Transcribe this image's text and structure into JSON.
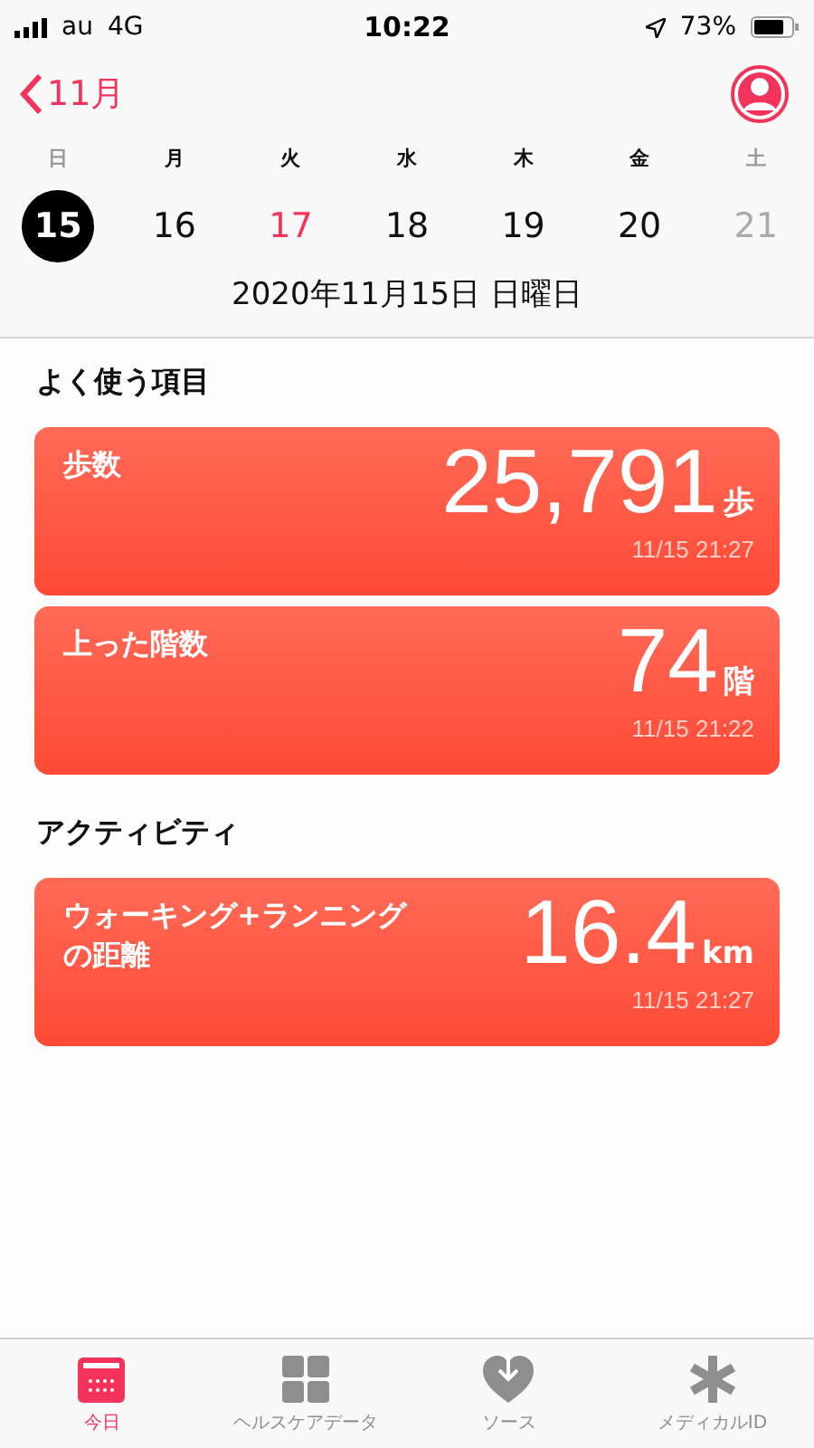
{
  "status_bar": {
    "carrier": "au",
    "network": "4G",
    "time": "10:22",
    "battery": "73%"
  },
  "nav": {
    "back": "11月"
  },
  "week": [
    {
      "weekday": "日",
      "day": "15",
      "weekend": true,
      "selected": true,
      "kind": "past"
    },
    {
      "weekday": "月",
      "day": "16",
      "weekend": false,
      "selected": false,
      "kind": "past"
    },
    {
      "weekday": "火",
      "day": "17",
      "weekend": false,
      "selected": false,
      "kind": "today"
    },
    {
      "weekday": "水",
      "day": "18",
      "weekend": false,
      "selected": false,
      "kind": "past"
    },
    {
      "weekday": "木",
      "day": "19",
      "weekend": false,
      "selected": false,
      "kind": "past"
    },
    {
      "weekday": "金",
      "day": "20",
      "weekend": false,
      "selected": false,
      "kind": "past"
    },
    {
      "weekday": "土",
      "day": "21",
      "weekend": true,
      "selected": false,
      "kind": "future"
    }
  ],
  "date_heading": "2020年11月15日 日曜日",
  "sections": [
    {
      "title": "よく使う項目",
      "cards": [
        {
          "label": "歩数",
          "value": "25,791",
          "unit": "歩",
          "time": "11/15 21:27"
        },
        {
          "label": "上った階数",
          "value": "74",
          "unit": "階",
          "time": "11/15 21:22"
        }
      ]
    },
    {
      "title": "アクティビティ",
      "cards": [
        {
          "label": "ウォーキング+ランニングの距離",
          "value": "16.4",
          "unit": "km",
          "time": "11/15 21:27"
        }
      ]
    }
  ],
  "tab_bar": [
    {
      "label": "今日",
      "kind": "calendar",
      "selected": true
    },
    {
      "label": "ヘルスケアデータ",
      "kind": "grid",
      "selected": false
    },
    {
      "label": "ソース",
      "kind": "heart",
      "selected": false
    },
    {
      "label": "メディカルID",
      "kind": "asterisk",
      "selected": false
    }
  ]
}
